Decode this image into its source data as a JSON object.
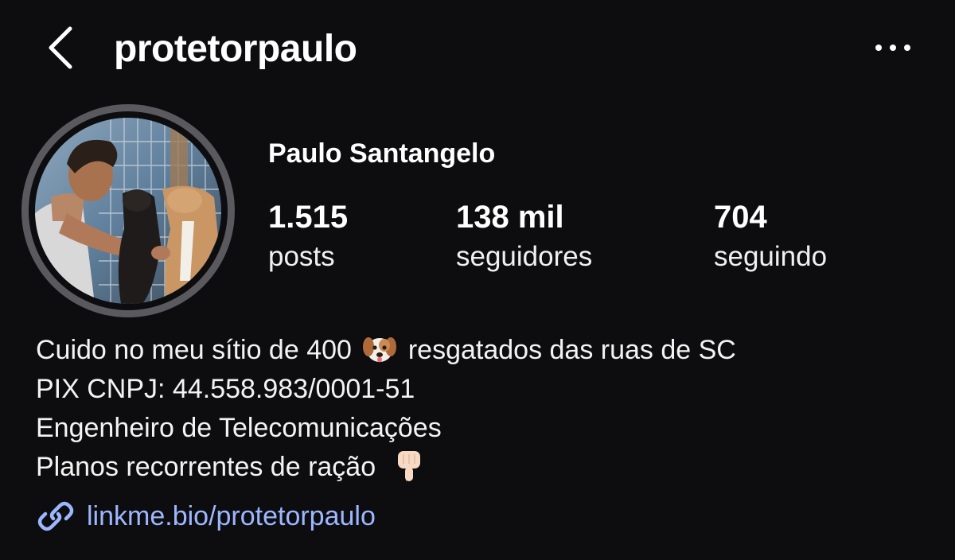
{
  "header": {
    "username": "protetorpaulo",
    "back_icon": "chevron-left-icon",
    "more_icon": "more-horizontal-icon"
  },
  "profile": {
    "display_name": "Paulo Santangelo",
    "avatar": "profile-photo"
  },
  "stats": {
    "posts": {
      "value": "1.515",
      "label": "posts"
    },
    "followers": {
      "value": "138 mil",
      "label": "seguidores"
    },
    "following": {
      "value": "704",
      "label": "seguindo"
    }
  },
  "bio": {
    "line1_before": "Cuido no meu sítio de 400",
    "line1_emoji": "dog-face-emoji",
    "line1_after": "resgatados das ruas de SC",
    "line2": "PIX CNPJ: 44.558.983/0001-51",
    "line3": "Engenheiro de Telecomunicações",
    "line4": "Planos recorrentes de ração",
    "line4_emoji": "pointing-down-hand-emoji"
  },
  "link": {
    "text": "linkme.bio/protetorpaulo",
    "icon": "link-icon"
  },
  "colors": {
    "background": "#0d0d10",
    "text": "#f5f5f5",
    "link": "#9db7ff",
    "avatar_ring": "#5a5a5e"
  }
}
